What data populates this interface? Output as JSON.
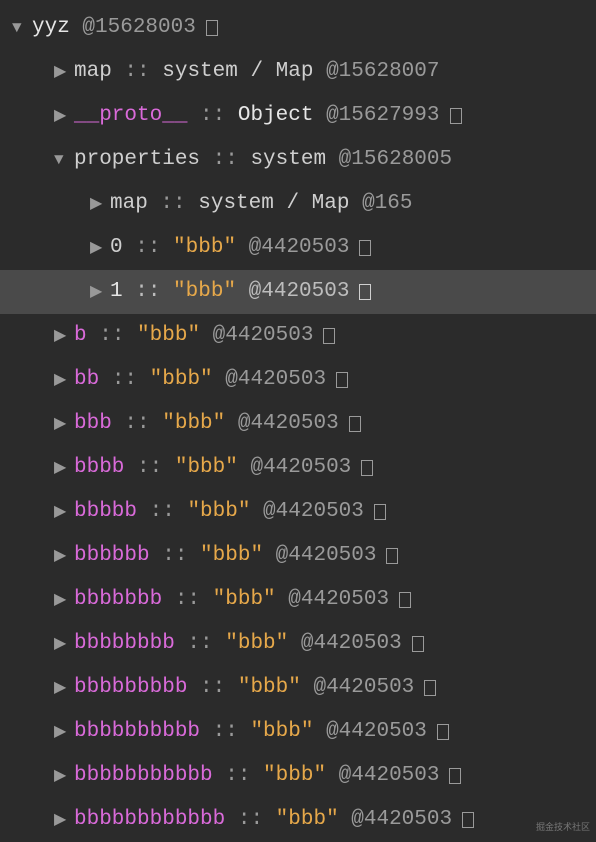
{
  "root": {
    "name": "yyz",
    "addr": "@15628003",
    "expanded": true,
    "box": true
  },
  "d1": {
    "map": {
      "key": "map",
      "sep1": " :: ",
      "type": "system / Map",
      "addr": " @15628007",
      "expanded": false
    },
    "proto": {
      "key": "__proto__",
      "sep1": " :: ",
      "type": "Object",
      "addr": " @15627993",
      "box": true,
      "expanded": false,
      "magentaKey": true
    },
    "props": {
      "key": "properties",
      "sep1": " :: ",
      "type": "system",
      "addr": " @15628005",
      "expanded": true
    }
  },
  "d2": {
    "map2": {
      "key": "map",
      "sep1": " :: ",
      "type": "system / Map",
      "addr": " @165",
      "expanded": false
    },
    "idx0": {
      "key": "0",
      "sep1": " :: ",
      "val": "\"bbb\"",
      "addr": " @4420503",
      "box": true,
      "expanded": false
    },
    "idx1": {
      "key": "1",
      "sep1": " :: ",
      "val": "\"bbb\"",
      "addr": " @4420503",
      "box": true,
      "expanded": false
    }
  },
  "bprops": [
    {
      "key": "b",
      "val": "\"bbb\"",
      "addr": " @4420503"
    },
    {
      "key": "bb",
      "val": "\"bbb\"",
      "addr": " @4420503"
    },
    {
      "key": "bbb",
      "val": "\"bbb\"",
      "addr": " @4420503"
    },
    {
      "key": "bbbb",
      "val": "\"bbb\"",
      "addr": " @4420503"
    },
    {
      "key": "bbbbb",
      "val": "\"bbb\"",
      "addr": " @4420503"
    },
    {
      "key": "bbbbbb",
      "val": "\"bbb\"",
      "addr": " @4420503"
    },
    {
      "key": "bbbbbbb",
      "val": "\"bbb\"",
      "addr": " @4420503"
    },
    {
      "key": "bbbbbbbb",
      "val": "\"bbb\"",
      "addr": " @4420503"
    },
    {
      "key": "bbbbbbbbb",
      "val": "\"bbb\"",
      "addr": " @4420503"
    },
    {
      "key": "bbbbbbbbbb",
      "val": "\"bbb\"",
      "addr": " @4420503"
    },
    {
      "key": "bbbbbbbbbbb",
      "val": "\"bbb\"",
      "addr": " @4420503"
    },
    {
      "key": "bbbbbbbbbbbb",
      "val": "\"bbb\"",
      "addr": " @4420503"
    }
  ],
  "sep_colon": " :: ",
  "watermark": "掘金技术社区"
}
